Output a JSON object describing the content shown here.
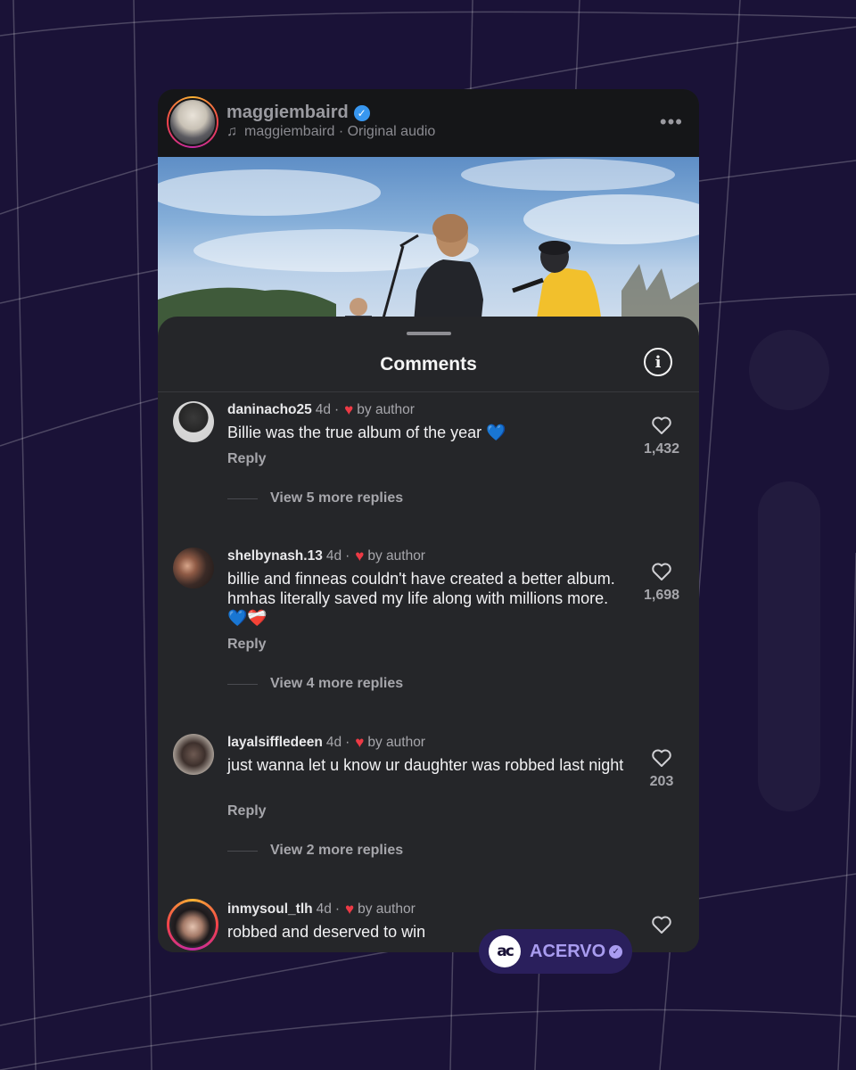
{
  "post": {
    "username": "maggiembaird",
    "audio_label": "maggiembaird · Original audio"
  },
  "comments_sheet": {
    "title": "Comments"
  },
  "comments": [
    {
      "username": "daninacho25",
      "time": "4d",
      "separator": "·",
      "liked_label": "by author",
      "text": "Billie was the true album of the year 💙",
      "reply_label": "Reply",
      "view_replies": "View 5 more replies",
      "likes": "1,432"
    },
    {
      "username": "shelbynash.13",
      "time": "4d",
      "separator": "·",
      "liked_label": "by author",
      "text": "billie and finneas couldn't have created a better album. hmhas literally saved my life along with millions more. 💙❤️‍🩹",
      "reply_label": "Reply",
      "view_replies": "View 4 more replies",
      "likes": "1,698"
    },
    {
      "username": "layalsiffledeen",
      "time": "4d",
      "separator": "·",
      "liked_label": "by author",
      "text": "just wanna let u know ur daughter was robbed last night",
      "reply_label": "Reply",
      "view_replies": "View 2 more replies",
      "likes": "203"
    },
    {
      "username": "inmysoul_tlh",
      "time": "4d",
      "separator": "·",
      "liked_label": "by author",
      "text": "robbed and deserved to win",
      "likes": ""
    }
  ],
  "watermark": {
    "logo_text": "ac",
    "brand": "ACERVO"
  },
  "colors": {
    "background": "#1a1237",
    "sheet": "#252629",
    "header": "#151618",
    "accent_heart": "#ed3a45",
    "verified": "#3897f0",
    "watermark_text": "#a99cf0"
  }
}
